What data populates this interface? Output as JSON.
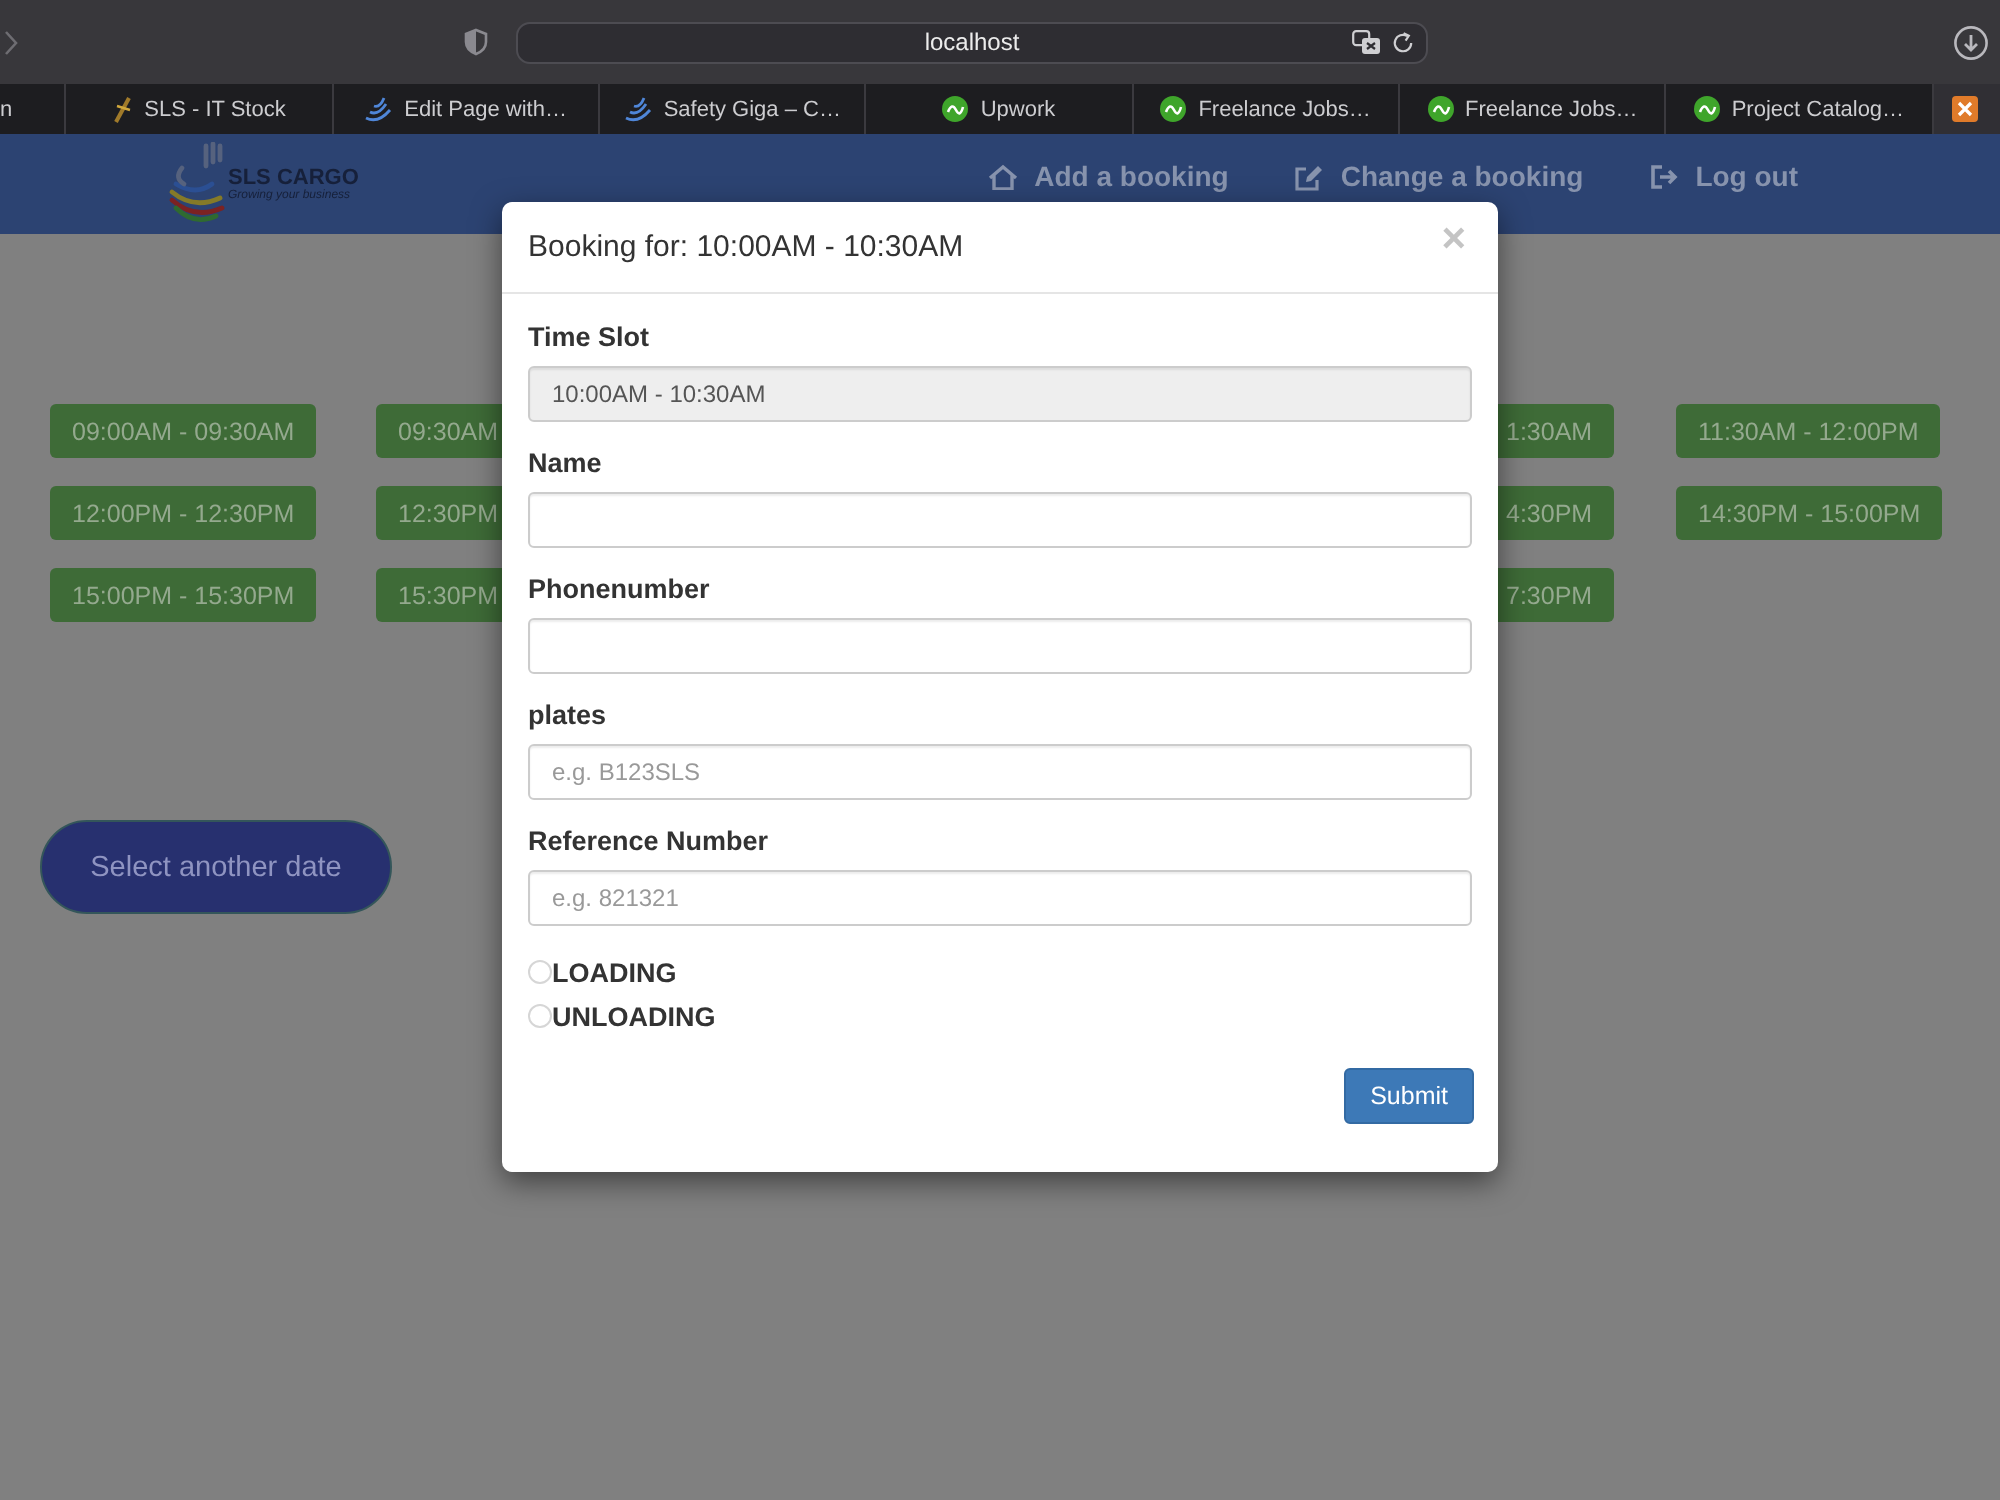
{
  "browser": {
    "url": "localhost",
    "tabs": [
      {
        "label": "n",
        "kind": "plain",
        "selected": false
      },
      {
        "label": "SLS - IT Stock",
        "kind": "pen",
        "selected": false
      },
      {
        "label": "Edit Page with…",
        "kind": "swoosh",
        "selected": false
      },
      {
        "label": "Safety Giga – C…",
        "kind": "swoosh",
        "selected": false
      },
      {
        "label": "Upwork",
        "kind": "circle",
        "selected": false
      },
      {
        "label": "Freelance Jobs…",
        "kind": "circle",
        "selected": false
      },
      {
        "label": "Freelance Jobs…",
        "kind": "circle",
        "selected": false
      },
      {
        "label": "Project Catalog…",
        "kind": "circle",
        "selected": false
      },
      {
        "kind": "square",
        "selected": true
      }
    ]
  },
  "header": {
    "logo": {
      "title": "SLS CARGO",
      "tagline": "Growing your business"
    },
    "nav": [
      {
        "label": "Add a booking",
        "kind": "home"
      },
      {
        "label": "Change a booking",
        "kind": "edit"
      },
      {
        "label": "Log out",
        "kind": "logout"
      }
    ]
  },
  "slots": [
    {
      "left": [
        {
          "label": "09:00AM - 09:30AM",
          "kind": "full"
        },
        {
          "label": "09:30AM",
          "kind": "cut"
        }
      ],
      "right": [
        {
          "label": "1:30AM",
          "kind": "cut"
        },
        {
          "label": "11:30AM - 12:00PM",
          "kind": "full"
        }
      ]
    },
    {
      "left": [
        {
          "label": "12:00PM - 12:30PM",
          "kind": "full"
        },
        {
          "label": "12:30PM",
          "kind": "cut"
        }
      ],
      "right": [
        {
          "label": "4:30PM",
          "kind": "cut"
        },
        {
          "label": "14:30PM - 15:00PM",
          "kind": "full"
        }
      ]
    },
    {
      "left": [
        {
          "label": "15:00PM - 15:30PM",
          "kind": "full"
        },
        {
          "label": "15:30PM",
          "kind": "cut"
        }
      ],
      "right": [
        {
          "label": "7:30PM",
          "kind": "cut"
        }
      ]
    }
  ],
  "select_date_button": "Select another date",
  "modal": {
    "title": "Booking for: 10:00AM - 10:30AM",
    "close": "×",
    "fields": [
      {
        "label": "Time Slot",
        "value": "10:00AM - 10:30AM",
        "disabled": true
      },
      {
        "label": "Name",
        "disabled": false
      },
      {
        "label": "Phonenumber",
        "disabled": false
      },
      {
        "label": "plates",
        "placeholder": "e.g. B123SLS",
        "disabled": false
      },
      {
        "label": "Reference Number",
        "placeholder": "e.g. 821321",
        "disabled": false
      }
    ],
    "options": [
      {
        "label": "LOADING",
        "selected": false
      },
      {
        "label": "UNLOADING",
        "selected": false
      }
    ],
    "submit": "Submit"
  }
}
